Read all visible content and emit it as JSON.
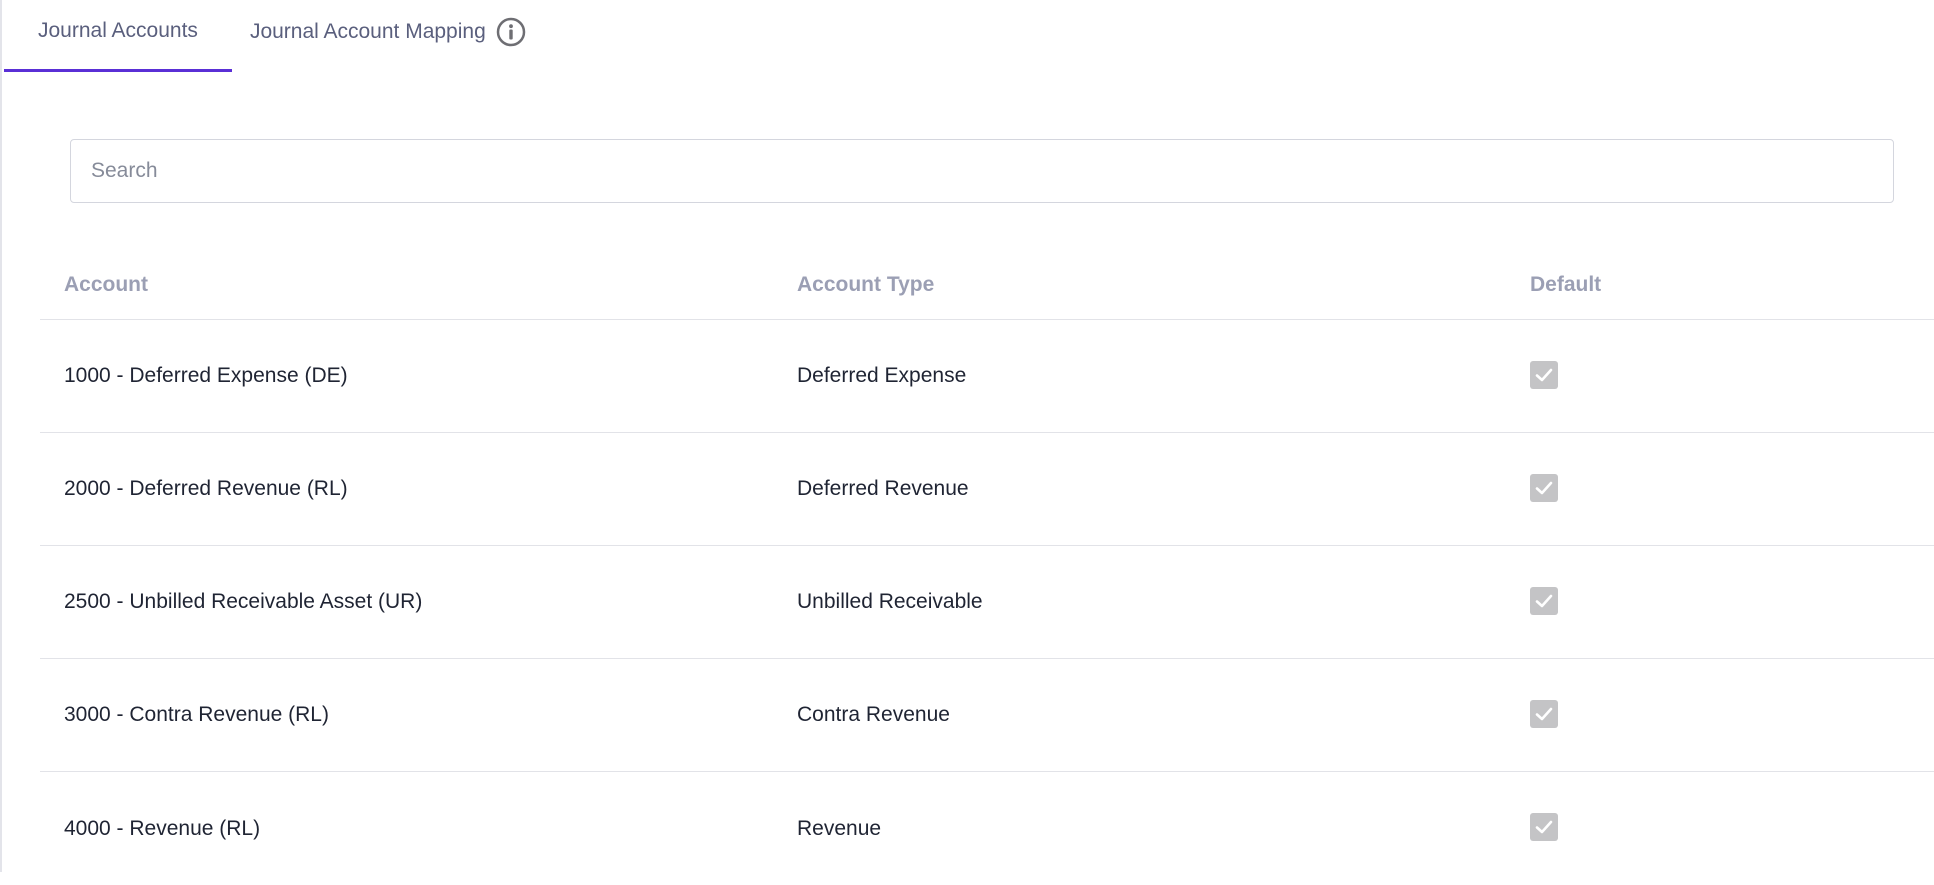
{
  "tabs": [
    {
      "label": "Journal Accounts",
      "active": true
    },
    {
      "label": "Journal Account Mapping",
      "active": false,
      "icon": "info-icon"
    }
  ],
  "search": {
    "placeholder": "Search",
    "value": ""
  },
  "table": {
    "headers": [
      "Account",
      "Account Type",
      "Default"
    ],
    "rows": [
      {
        "account": "1000 - Deferred Expense (DE)",
        "type": "Deferred Expense",
        "default": true
      },
      {
        "account": "2000 - Deferred Revenue (RL)",
        "type": "Deferred Revenue",
        "default": true
      },
      {
        "account": "2500 - Unbilled Receivable Asset (UR)",
        "type": "Unbilled Receivable",
        "default": true
      },
      {
        "account": "3000 - Contra Revenue (RL)",
        "type": "Contra Revenue",
        "default": true
      },
      {
        "account": "4000 - Revenue (RL)",
        "type": "Revenue",
        "default": true
      }
    ]
  },
  "colors": {
    "accent": "#5a2fd6",
    "checkbox_disabled": "#c4c4c6",
    "header_text": "#9b9fb4"
  }
}
